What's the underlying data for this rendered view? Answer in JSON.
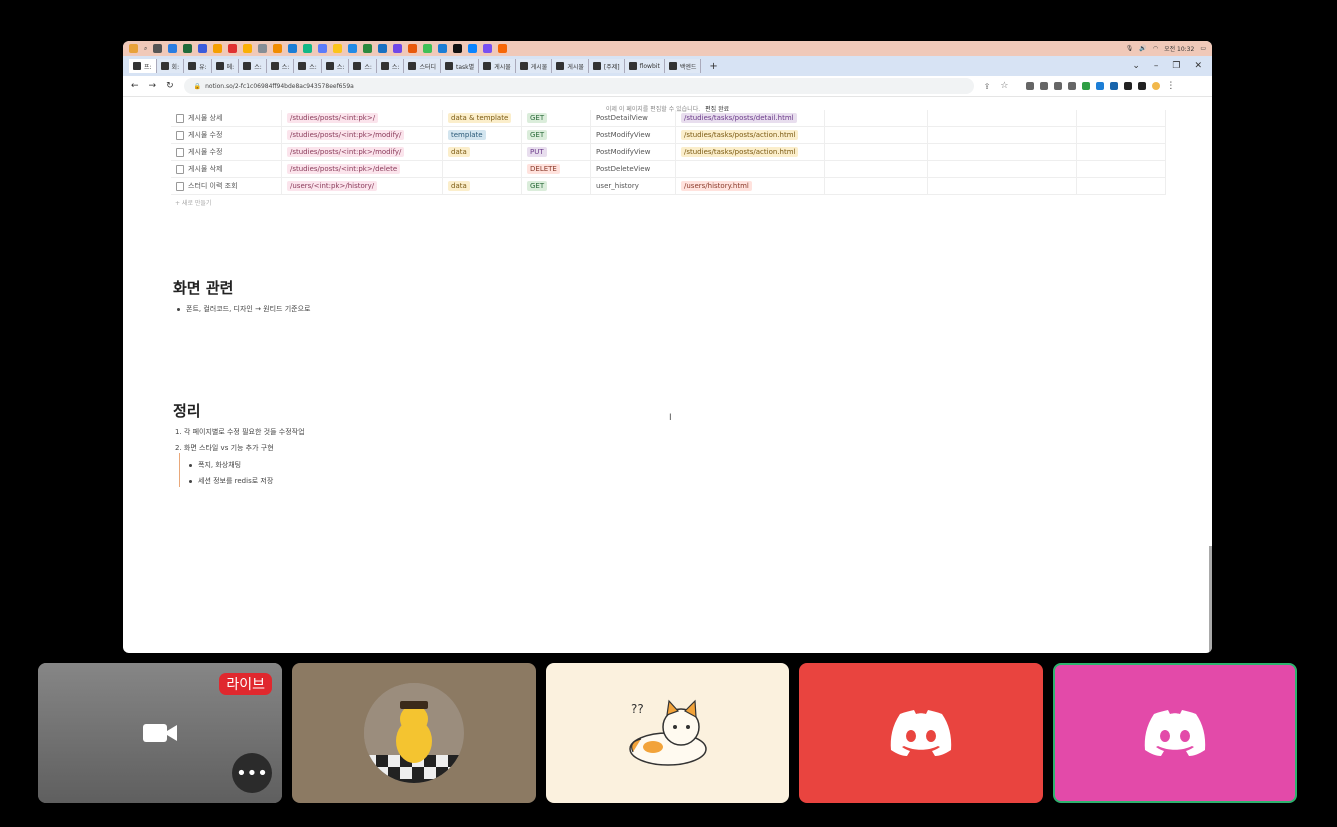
{
  "taskbar": {
    "clock": "오전 10:32"
  },
  "tabs": [
    {
      "label": "프:"
    },
    {
      "label": "회:"
    },
    {
      "label": "유:"
    },
    {
      "label": "메:"
    },
    {
      "label": "스:"
    },
    {
      "label": "스:"
    },
    {
      "label": "스:"
    },
    {
      "label": "스:"
    },
    {
      "label": "스:"
    },
    {
      "label": "스:"
    },
    {
      "label": "스터디"
    },
    {
      "label": "task별"
    },
    {
      "label": "게시물"
    },
    {
      "label": "게시물"
    },
    {
      "label": "게시물"
    },
    {
      "label": "[주제]"
    },
    {
      "label": "flowbit"
    },
    {
      "label": "백엔드"
    }
  ],
  "browser": {
    "url": "notion.so/2-fc1c06984ff94bde8ac943578eef659a"
  },
  "notion": {
    "banner_text": "이제 이 페이지를 편집할 수 있습니다.",
    "banner_link": "편집 완료",
    "table_rows": [
      {
        "name": "게시물 상세",
        "url": "/studies/posts/<int:pk>/",
        "type": "data & template",
        "method": "GET",
        "view": "PostDetailView",
        "template": "/studies/tasks/posts/detail.html"
      },
      {
        "name": "게시물 수정",
        "url": "/studies/posts/<int:pk>/modify/",
        "type": "template",
        "method": "GET",
        "view": "PostModifyView",
        "template": "/studies/tasks/posts/action.html"
      },
      {
        "name": "게시물 수정",
        "url": "/studies/posts/<int:pk>/modify/",
        "type": "data",
        "method": "PUT",
        "view": "PostModifyView",
        "template": "/studies/tasks/posts/action.html"
      },
      {
        "name": "게시물 삭제",
        "url": "/studies/posts/<int:pk>/delete",
        "type": "",
        "method": "DELETE",
        "view": "PostDeleteView",
        "template": ""
      },
      {
        "name": "스터디 이력 조회",
        "url": "/users/<int:pk>/history/",
        "type": "data",
        "method": "GET",
        "view": "user_history",
        "template": "/users/history.html"
      }
    ],
    "new_row": "+ 새로 만들기",
    "section1_title": "화면 관련",
    "section1_bullet": "폰트, 컬러코드, 디자인 → 원티드 기준으로",
    "section2_title": "정리",
    "section2_items": [
      "1.  각 페이지별로 수정 필요한 것들 수정작업",
      "2.  화면 스타일 vs 기능 추가 구현"
    ],
    "section2_sub": [
      "폭지, 화상채팅",
      "세션 정보를 redis로 저장"
    ]
  },
  "call": {
    "live_label": "라이브",
    "more_label": "•••"
  },
  "colors": {
    "tile_red": "#e9443f",
    "tile_pink": "#e34aa9",
    "speaking_border": "#2eb36f"
  }
}
